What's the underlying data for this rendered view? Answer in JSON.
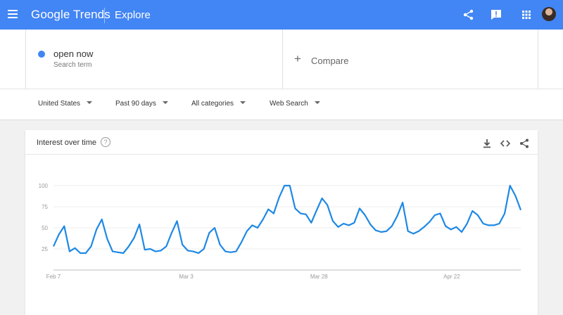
{
  "header": {
    "logo_google": "Google",
    "logo_trends": "Trends",
    "title": "Explore"
  },
  "search_term": {
    "label": "open now",
    "type": "Search term",
    "color": "#4285f4"
  },
  "compare": {
    "label": "Compare"
  },
  "filters": {
    "region": "United States",
    "time": "Past 90 days",
    "category": "All categories",
    "property": "Web Search"
  },
  "card": {
    "title": "Interest over time"
  },
  "icons": [
    "menu-icon",
    "share-icon",
    "feedback-icon",
    "apps-icon",
    "avatar",
    "help-icon",
    "download-icon",
    "embed-icon",
    "share-icon"
  ],
  "chart_data": {
    "type": "line",
    "series": [
      {
        "values": [
          28,
          42,
          52,
          22,
          26,
          20,
          20,
          28,
          48,
          60,
          37,
          22,
          21,
          20,
          28,
          38,
          54,
          24,
          25,
          22,
          23,
          28,
          44,
          58,
          30,
          23,
          22,
          20,
          25,
          44,
          50,
          30,
          22,
          21,
          22,
          33,
          46,
          53,
          50,
          60,
          72,
          67,
          86,
          100,
          100,
          73,
          67,
          66,
          56,
          71,
          85,
          77,
          58,
          51,
          55,
          53,
          56,
          73,
          65,
          54,
          47,
          45,
          46,
          52,
          64,
          80,
          46,
          43,
          46,
          51,
          57,
          65,
          67,
          52,
          48,
          51,
          45,
          55,
          70,
          65,
          55,
          53,
          53,
          55,
          67,
          100,
          88,
          71
        ],
        "color": "#1e88e5"
      }
    ],
    "x_ticks": [
      "Feb 7",
      "Mar 3",
      "Mar 28",
      "Apr 22"
    ],
    "y_ticks": [
      "25",
      "50",
      "75",
      "100"
    ],
    "ylim": [
      0,
      100
    ],
    "grid": true
  }
}
